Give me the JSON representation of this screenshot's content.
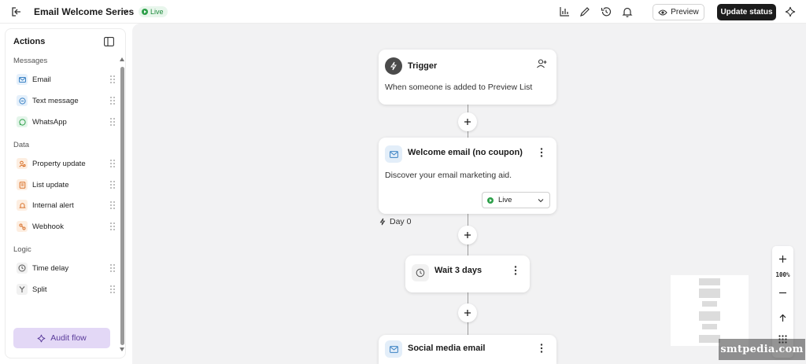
{
  "topbar": {
    "flow_title": "Email Welcome Series",
    "status_badge": "Live",
    "preview_label": "Preview",
    "update_label": "Update status"
  },
  "sidebar": {
    "title": "Actions",
    "sections": [
      {
        "label": "Messages",
        "items": [
          {
            "label": "Email",
            "icon": "mail-icon"
          },
          {
            "label": "Text message",
            "icon": "sms-icon"
          },
          {
            "label": "WhatsApp",
            "icon": "whatsapp-icon"
          }
        ]
      },
      {
        "label": "Data",
        "items": [
          {
            "label": "Property update",
            "icon": "user-properties-icon"
          },
          {
            "label": "List update",
            "icon": "list-icon"
          },
          {
            "label": "Internal alert",
            "icon": "bell-icon"
          },
          {
            "label": "Webhook",
            "icon": "webhook-icon"
          }
        ]
      },
      {
        "label": "Logic",
        "items": [
          {
            "label": "Time delay",
            "icon": "clock-icon"
          },
          {
            "label": "Split",
            "icon": "split-icon"
          }
        ]
      }
    ],
    "audit_label": "Audit flow"
  },
  "canvas": {
    "trigger": {
      "title": "Trigger",
      "body": "When someone is added to Preview List"
    },
    "email1": {
      "title": "Welcome email (no coupon)",
      "body": "Discover your email marketing aid.",
      "status": "Live"
    },
    "day_label": "Day 0",
    "wait": {
      "title": "Wait 3 days"
    },
    "email2": {
      "title": "Social media email"
    }
  },
  "zoom": {
    "level": "100%"
  },
  "watermark": "smtpedia.com",
  "colors": {
    "accent_live": "#2ea04a",
    "primary_button": "#1c1c1c",
    "audit_button": "#e3d8f6",
    "canvas_bg": "#f2f2f3"
  }
}
